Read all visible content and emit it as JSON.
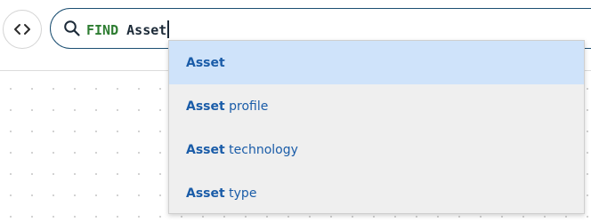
{
  "toolbar": {
    "toggle_icon": "code-brackets-icon"
  },
  "search": {
    "icon": "search-icon",
    "keyword": "FIND",
    "query": "Asset",
    "border_color": "#1c4f72",
    "keyword_color": "#2e7d32"
  },
  "suggestions": {
    "highlight_color": "#cfe3fa",
    "text_color": "#1a5ca8",
    "items": [
      {
        "match": "Asset",
        "rest": "",
        "selected": true
      },
      {
        "match": "Asset",
        "rest": " profile",
        "selected": false
      },
      {
        "match": "Asset",
        "rest": " technology",
        "selected": false
      },
      {
        "match": "Asset",
        "rest": " type",
        "selected": false
      }
    ]
  }
}
